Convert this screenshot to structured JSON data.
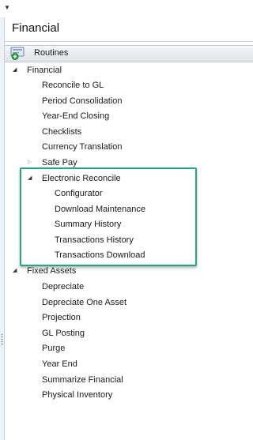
{
  "panel": {
    "title": "Financial"
  },
  "routines": {
    "label": "Routines"
  },
  "tree": {
    "financial": {
      "label": "Financial",
      "children": [
        "Reconcile to GL",
        "Period Consolidation",
        "Year-End Closing",
        "Checklists",
        "Currency Translation",
        "Safe Pay"
      ],
      "electronic_reconcile": {
        "label": "Electronic Reconcile",
        "children": [
          "Configurator",
          "Download Maintenance",
          "Summary History",
          "Transactions History",
          "Transactions Download"
        ]
      }
    },
    "fixed_assets": {
      "label": "Fixed Assets",
      "children": [
        "Depreciate",
        "Depreciate One Asset",
        "Projection",
        "GL Posting",
        "Purge",
        "Year End",
        "Summarize Financial",
        "Physical Inventory"
      ]
    }
  },
  "colors": {
    "highlight": "#27a486"
  }
}
